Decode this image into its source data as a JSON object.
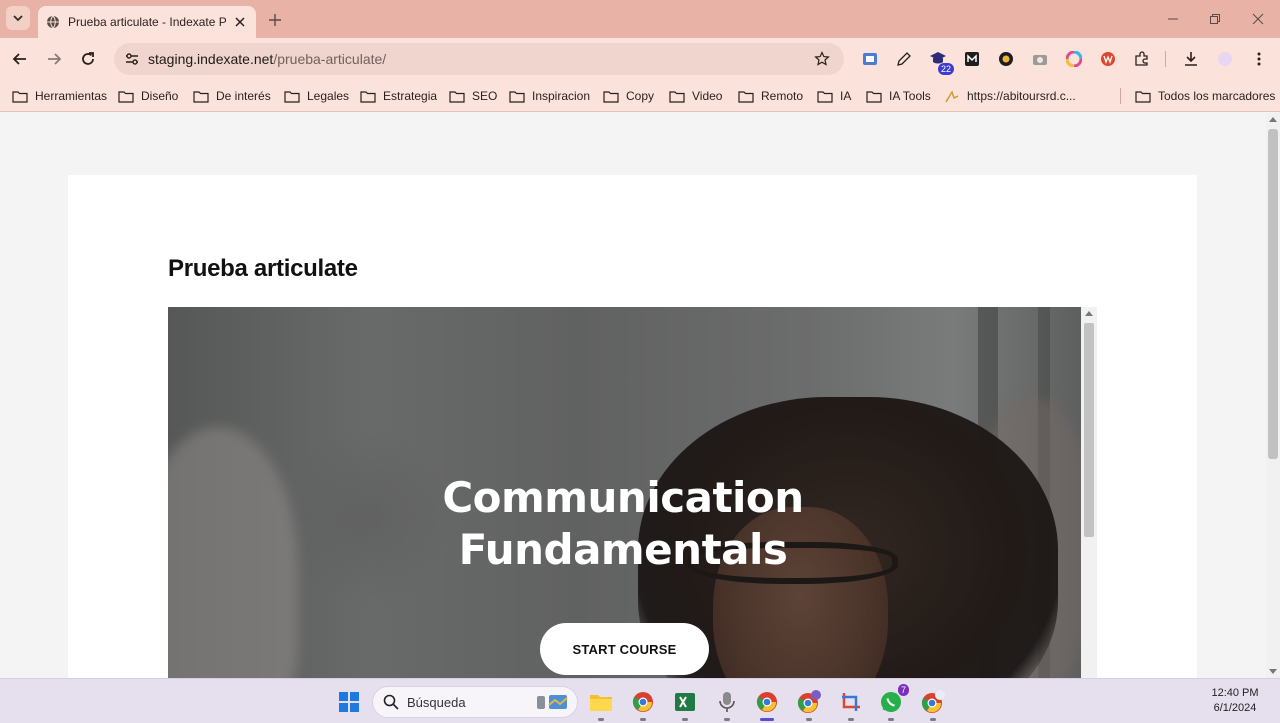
{
  "browser": {
    "tab_title": "Prueba articulate - Indexate Pru",
    "url_host": "staging.indexate.net",
    "url_path": "/prueba-articulate/",
    "extension_badge": "22"
  },
  "bookmarks": [
    {
      "label": "Herramientas"
    },
    {
      "label": "Diseño"
    },
    {
      "label": "De interés"
    },
    {
      "label": "Legales"
    },
    {
      "label": "Estrategia"
    },
    {
      "label": "SEO"
    },
    {
      "label": "Inspiracion"
    },
    {
      "label": "Copy"
    },
    {
      "label": "Video"
    },
    {
      "label": "Remoto"
    },
    {
      "label": "IA"
    },
    {
      "label": "IA Tools"
    },
    {
      "label": "https://abitoursrd.c..."
    },
    {
      "label": "Todos los marcadores"
    }
  ],
  "page": {
    "title": "Prueba articulate",
    "course_title": "Communication Fundamentals",
    "start_button": "START COURSE"
  },
  "taskbar": {
    "search_label": "Búsqueda",
    "whatsapp_badge": "7",
    "time": "12:40 PM",
    "date": "6/1/2024"
  },
  "colors": {
    "chrome_tabstrip": "#e8b3a6",
    "chrome_toolbar": "#fbe3dc",
    "taskbar": "#e6e0ee"
  }
}
